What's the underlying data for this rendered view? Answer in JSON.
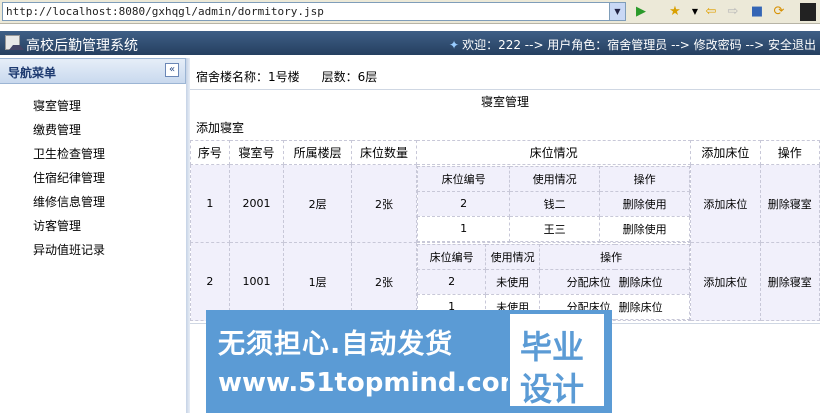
{
  "browser": {
    "url": "http://localhost:8080/gxhqgl/admin/dormitory.jsp",
    "go_icon": "go-arrow-icon",
    "favorites_icon": "star-icon",
    "back_icon": "back-arrow-icon",
    "forward_icon": "forward-arrow-icon",
    "stop_icon": "stop-icon",
    "refresh_icon": "refresh-icon"
  },
  "app": {
    "title": "高校后勤管理系统",
    "header_right": "欢迎：222 --> 用户角色：宿舍管理员 --> 修改密码 --> 安全退出"
  },
  "sidebar": {
    "title": "导航菜单",
    "collapse_label": "«",
    "items": [
      {
        "label": "寝室管理"
      },
      {
        "label": "缴费管理"
      },
      {
        "label": "卫生检查管理"
      },
      {
        "label": "住宿纪律管理"
      },
      {
        "label": "维修信息管理"
      },
      {
        "label": "访客管理"
      },
      {
        "label": "异动值班记录"
      }
    ]
  },
  "content": {
    "building_name": "宿舍楼名称：1号楼",
    "floor_count": "层数：6层",
    "section_title": "寝室管理",
    "add_room_label": "添加寝室",
    "columns": [
      "序号",
      "寝室号",
      "所属楼层",
      "床位数量",
      "床位情况",
      "添加床位",
      "操作"
    ],
    "bed_columns": [
      "床位编号",
      "使用情况",
      "操作"
    ],
    "rooms": [
      {
        "index": "1",
        "room_no": "2001",
        "floor": "2层",
        "bed_count": "2张",
        "beds": [
          {
            "bed_no": "2",
            "usage": "钱二",
            "action": "删除使用"
          },
          {
            "bed_no": "1",
            "usage": "王三",
            "action": "删除使用"
          }
        ],
        "add_bed": "添加床位",
        "op": "删除寝室"
      },
      {
        "index": "2",
        "room_no": "1001",
        "floor": "1层",
        "bed_count": "2张",
        "beds": [
          {
            "bed_no": "2",
            "usage": "未使用",
            "action1": "分配床位",
            "action2": "删除床位"
          },
          {
            "bed_no": "1",
            "usage": "未使用",
            "action1": "分配床位",
            "action2": "删除床位"
          }
        ],
        "add_bed": "添加床位",
        "op": "删除寝室"
      }
    ]
  },
  "watermark": {
    "line1": "无须担心.自动发货",
    "line2": "www.51topmind.com",
    "box1": "毕业",
    "box2": "设计"
  }
}
